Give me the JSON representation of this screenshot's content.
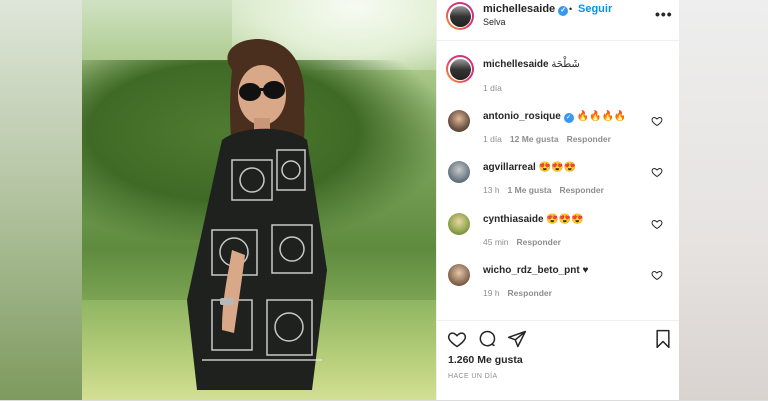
{
  "post": {
    "username": "michellesaide",
    "verified_mark": "✓",
    "dot": "•",
    "follow_label": "Seguir",
    "location": "Selva",
    "more_label": "•••"
  },
  "caption": {
    "username": "michellesaide",
    "text": "شَطْحَة",
    "time": "1 día"
  },
  "comments": [
    {
      "username": "antonio_rosique",
      "verified": true,
      "text": "🔥🔥🔥🔥",
      "time": "1 día",
      "likes": "12 Me gusta",
      "reply": "Responder"
    },
    {
      "username": "agvillarreal",
      "verified": false,
      "text": "😍😍😍",
      "time": "13 h",
      "likes": "1 Me gusta",
      "reply": "Responder"
    },
    {
      "username": "cynthiasaide",
      "verified": false,
      "text": "😍😍😍",
      "time": "45 min",
      "likes": "",
      "reply": "Responder"
    },
    {
      "username": "wicho_rdz_beto_pnt",
      "verified": false,
      "text": "♥",
      "time": "19 h",
      "likes": "",
      "reply": "Responder"
    }
  ],
  "footer": {
    "likes_count": "1.260 Me gusta",
    "time_ago": "HACE UN DÍA"
  },
  "icons": {
    "like": "heart-icon",
    "comment": "comment-icon",
    "share": "share-icon",
    "save": "bookmark-icon",
    "more": "more-options-icon"
  },
  "colors": {
    "link_blue": "#0095f6",
    "verified_blue": "#3897f0",
    "text": "#262626",
    "secondary": "#8e8e8e"
  }
}
